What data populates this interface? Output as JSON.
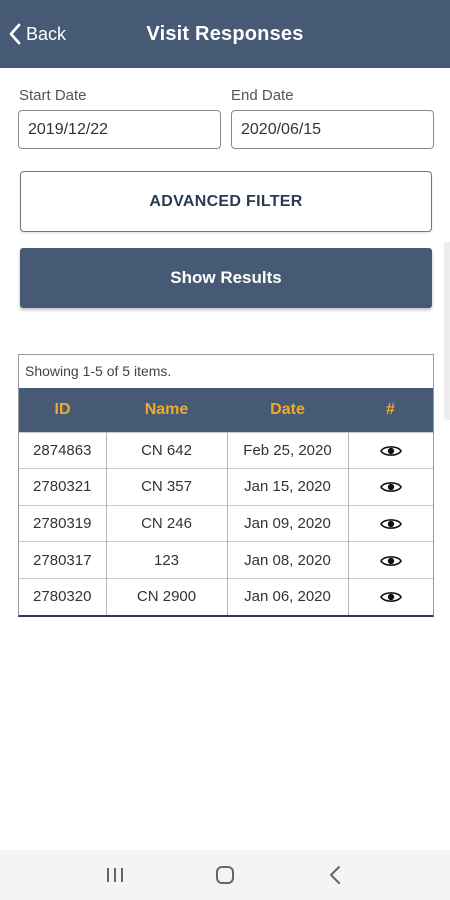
{
  "header": {
    "back_label": "Back",
    "title": "Visit Responses"
  },
  "filters": {
    "start_label": "Start Date",
    "start_value": "2019/12/22",
    "end_label": "End Date",
    "end_value": "2020/06/15",
    "advanced_label": "ADVANCED FILTER",
    "show_results_label": "Show Results"
  },
  "grid": {
    "summary": "Showing 1-5 of 5 items.",
    "columns": [
      "ID",
      "Name",
      "Date",
      "#"
    ],
    "rows": [
      {
        "id": "2874863",
        "name": "CN 642",
        "date": "Feb 25, 2020"
      },
      {
        "id": "2780321",
        "name": "CN 357",
        "date": "Jan 15, 2020"
      },
      {
        "id": "2780319",
        "name": "CN 246",
        "date": "Jan 09, 2020"
      },
      {
        "id": "2780317",
        "name": "123",
        "date": "Jan 08, 2020"
      },
      {
        "id": "2780320",
        "name": "CN 2900",
        "date": "Jan 06, 2020"
      }
    ],
    "action_icon": "eye-icon"
  },
  "colors": {
    "header_bg": "#475a75",
    "header_text_accent": "#f0a92a",
    "brand_dark": "#2b3a52"
  },
  "system_nav": {
    "icons": [
      "recent-apps-icon",
      "home-icon",
      "back-nav-icon"
    ]
  }
}
